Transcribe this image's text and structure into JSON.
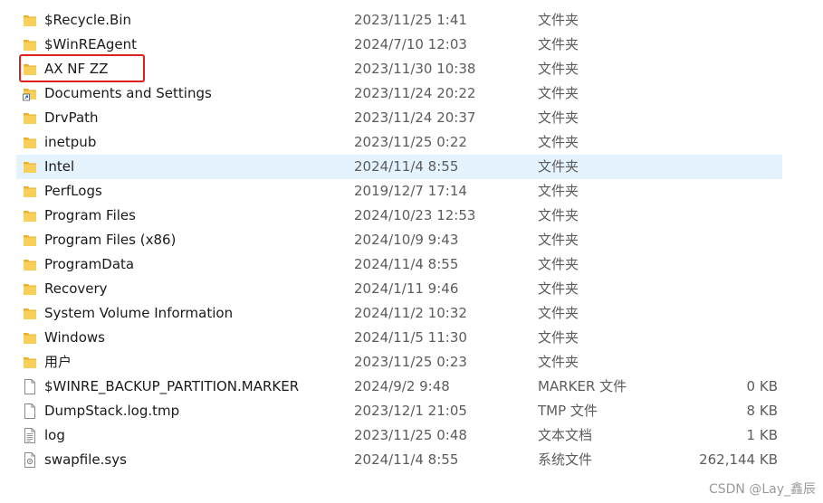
{
  "files": [
    {
      "name": "$Recycle.Bin",
      "date": "2023/11/25 1:41",
      "type": "文件夹",
      "size": "",
      "icon": "folder-icon"
    },
    {
      "name": "$WinREAgent",
      "date": "2024/7/10 12:03",
      "type": "文件夹",
      "size": "",
      "icon": "folder-icon"
    },
    {
      "name": "AX NF ZZ",
      "date": "2023/11/30 10:38",
      "type": "文件夹",
      "size": "",
      "icon": "folder-icon"
    },
    {
      "name": "Documents and Settings",
      "date": "2023/11/24 20:22",
      "type": "文件夹",
      "size": "",
      "icon": "folder-shortcut-icon"
    },
    {
      "name": "DrvPath",
      "date": "2023/11/24 20:37",
      "type": "文件夹",
      "size": "",
      "icon": "folder-icon"
    },
    {
      "name": "inetpub",
      "date": "2023/11/25 0:22",
      "type": "文件夹",
      "size": "",
      "icon": "folder-icon"
    },
    {
      "name": "Intel",
      "date": "2024/11/4 8:55",
      "type": "文件夹",
      "size": "",
      "icon": "folder-icon"
    },
    {
      "name": "PerfLogs",
      "date": "2019/12/7 17:14",
      "type": "文件夹",
      "size": "",
      "icon": "folder-icon"
    },
    {
      "name": "Program Files",
      "date": "2024/10/23 12:53",
      "type": "文件夹",
      "size": "",
      "icon": "folder-icon"
    },
    {
      "name": "Program Files (x86)",
      "date": "2024/10/9 9:43",
      "type": "文件夹",
      "size": "",
      "icon": "folder-icon"
    },
    {
      "name": "ProgramData",
      "date": "2024/11/4 8:55",
      "type": "文件夹",
      "size": "",
      "icon": "folder-icon"
    },
    {
      "name": "Recovery",
      "date": "2024/1/11 9:46",
      "type": "文件夹",
      "size": "",
      "icon": "folder-icon"
    },
    {
      "name": "System Volume Information",
      "date": "2024/11/2 10:32",
      "type": "文件夹",
      "size": "",
      "icon": "folder-icon"
    },
    {
      "name": "Windows",
      "date": "2024/11/5 11:30",
      "type": "文件夹",
      "size": "",
      "icon": "folder-icon"
    },
    {
      "name": "用户",
      "date": "2023/11/25 0:23",
      "type": "文件夹",
      "size": "",
      "icon": "folder-icon"
    },
    {
      "name": "$WINRE_BACKUP_PARTITION.MARKER",
      "date": "2024/9/2 9:48",
      "type": "MARKER 文件",
      "size": "0 KB",
      "icon": "blank-file-icon"
    },
    {
      "name": "DumpStack.log.tmp",
      "date": "2023/12/1 21:05",
      "type": "TMP 文件",
      "size": "8 KB",
      "icon": "blank-file-icon"
    },
    {
      "name": "log",
      "date": "2023/11/25 0:48",
      "type": "文本文档",
      "size": "1 KB",
      "icon": "text-file-icon"
    },
    {
      "name": "swapfile.sys",
      "date": "2024/11/4 8:55",
      "type": "系统文件",
      "size": "262,144 KB",
      "icon": "system-file-icon"
    }
  ],
  "selected_index": 6,
  "highlighted_index": 2,
  "colors": {
    "selection": "#e5f3ff",
    "highlight_border": "#e02020",
    "folder": "#f5c542"
  },
  "watermark": "CSDN @Lay_鑫辰"
}
